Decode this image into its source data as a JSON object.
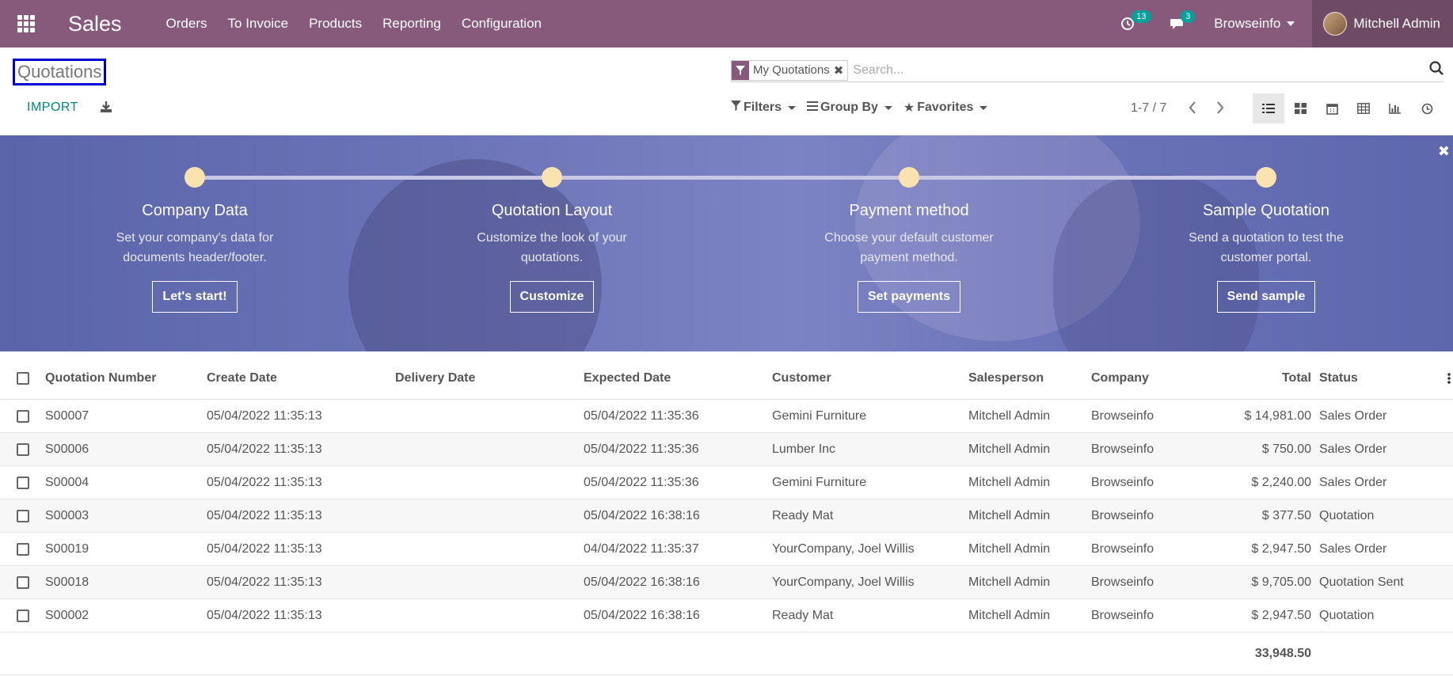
{
  "app": {
    "brand": "Sales",
    "menu": [
      "Orders",
      "To Invoice",
      "Products",
      "Reporting",
      "Configuration"
    ],
    "activities_count": "13",
    "messages_count": "3",
    "company_switcher": "Browseinfo",
    "user_name": "Mitchell Admin"
  },
  "control": {
    "title": "Quotations",
    "import_label": "IMPORT",
    "facet_label": "My Quotations",
    "search_placeholder": "Search...",
    "filters_label": "Filters",
    "groupby_label": "Group By",
    "favorites_label": "Favorites",
    "pager_text": "1-7 / 7"
  },
  "banner": {
    "steps": [
      {
        "title": "Company Data",
        "desc": "Set your company's data for documents header/footer.",
        "button": "Let's start!"
      },
      {
        "title": "Quotation Layout",
        "desc": "Customize the look of your quotations.",
        "button": "Customize"
      },
      {
        "title": "Payment method",
        "desc": "Choose your default customer payment method.",
        "button": "Set payments"
      },
      {
        "title": "Sample Quotation",
        "desc": "Send a quotation to test the customer portal.",
        "button": "Send sample"
      }
    ]
  },
  "table": {
    "headers": [
      "Quotation Number",
      "Create Date",
      "Delivery Date",
      "Expected Date",
      "Customer",
      "Salesperson",
      "Company",
      "Total",
      "Status"
    ],
    "rows": [
      {
        "number": "S00007",
        "create": "05/04/2022 11:35:13",
        "delivery": "",
        "expected": "05/04/2022 11:35:36",
        "customer": "Gemini Furniture",
        "salesperson": "Mitchell Admin",
        "company": "Browseinfo",
        "total": "$ 14,981.00",
        "status": "Sales Order"
      },
      {
        "number": "S00006",
        "create": "05/04/2022 11:35:13",
        "delivery": "",
        "expected": "05/04/2022 11:35:36",
        "customer": "Lumber Inc",
        "salesperson": "Mitchell Admin",
        "company": "Browseinfo",
        "total": "$ 750.00",
        "status": "Sales Order"
      },
      {
        "number": "S00004",
        "create": "05/04/2022 11:35:13",
        "delivery": "",
        "expected": "05/04/2022 11:35:36",
        "customer": "Gemini Furniture",
        "salesperson": "Mitchell Admin",
        "company": "Browseinfo",
        "total": "$ 2,240.00",
        "status": "Sales Order"
      },
      {
        "number": "S00003",
        "create": "05/04/2022 11:35:13",
        "delivery": "",
        "expected": "05/04/2022 16:38:16",
        "customer": "Ready Mat",
        "salesperson": "Mitchell Admin",
        "company": "Browseinfo",
        "total": "$ 377.50",
        "status": "Quotation"
      },
      {
        "number": "S00019",
        "create": "05/04/2022 11:35:13",
        "delivery": "",
        "expected": "04/04/2022 11:35:37",
        "customer": "YourCompany, Joel Willis",
        "salesperson": "Mitchell Admin",
        "company": "Browseinfo",
        "total": "$ 2,947.50",
        "status": "Sales Order"
      },
      {
        "number": "S00018",
        "create": "05/04/2022 11:35:13",
        "delivery": "",
        "expected": "05/04/2022 16:38:16",
        "customer": "YourCompany, Joel Willis",
        "salesperson": "Mitchell Admin",
        "company": "Browseinfo",
        "total": "$ 9,705.00",
        "status": "Quotation Sent"
      },
      {
        "number": "S00002",
        "create": "05/04/2022 11:35:13",
        "delivery": "",
        "expected": "05/04/2022 16:38:16",
        "customer": "Ready Mat",
        "salesperson": "Mitchell Admin",
        "company": "Browseinfo",
        "total": "$ 2,947.50",
        "status": "Quotation"
      }
    ],
    "sum_total": "33,948.50"
  },
  "colors": {
    "navbar": "#875a7b",
    "accent": "#00a09d",
    "import": "#008784",
    "title_outline": "#0000d0",
    "progress_dot": "#fbe3b0"
  }
}
